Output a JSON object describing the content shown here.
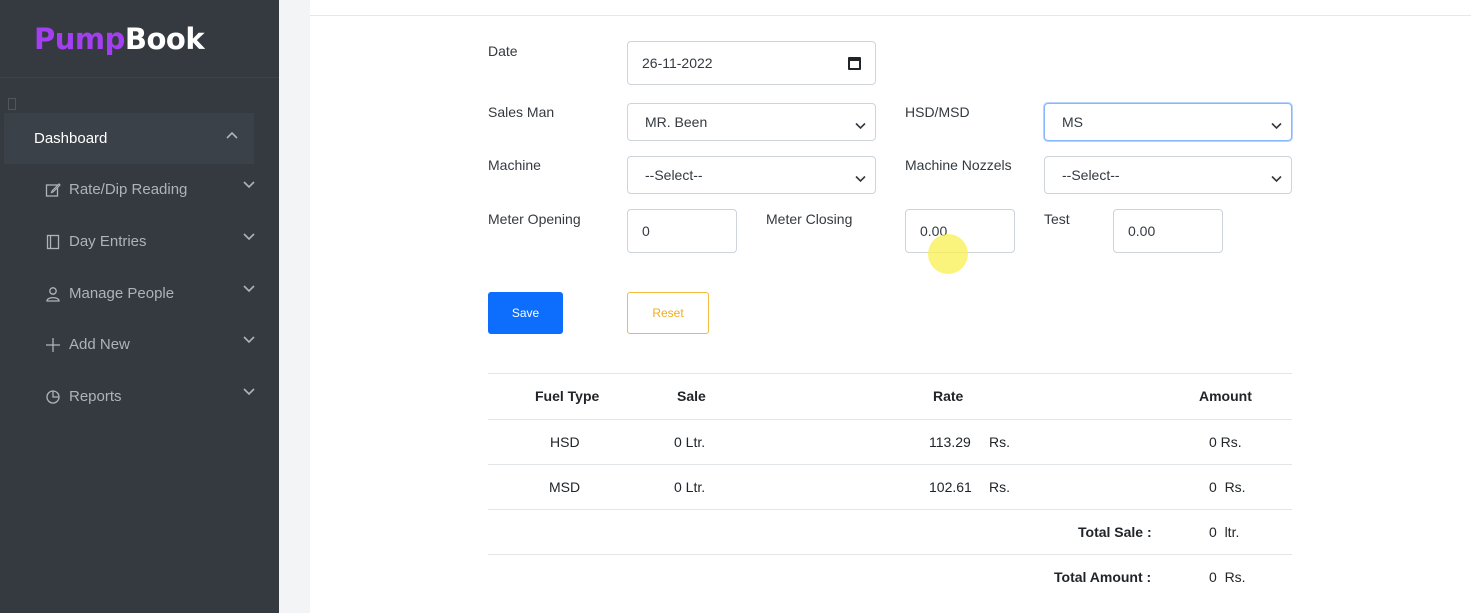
{
  "brand": {
    "part1": "Pump",
    "part2": "Book"
  },
  "sidebar": {
    "dashboard": "Dashboard",
    "items": [
      {
        "label": "Rate/Dip Reading",
        "icon": "edit-icon"
      },
      {
        "label": "Day Entries",
        "icon": "book-icon"
      },
      {
        "label": "Manage People",
        "icon": "person-icon"
      },
      {
        "label": "Add New",
        "icon": "plus-icon"
      },
      {
        "label": "Reports",
        "icon": "pie-chart-icon"
      }
    ]
  },
  "form": {
    "date_label": "Date",
    "date_value": "26-11-2022",
    "salesman_label": "Sales Man",
    "salesman_value": "MR. Been",
    "hsd_msd_label": "HSD/MSD",
    "hsd_msd_value": "MS",
    "machine_label": "Machine",
    "machine_value": "--Select--",
    "nozzles_label": "Machine Nozzels",
    "nozzles_value": "--Select--",
    "meter_opening_label": "Meter Opening",
    "meter_opening_value": "0",
    "meter_closing_label": "Meter Closing",
    "meter_closing_value": "0.00",
    "test_label": "Test",
    "test_value": "0.00",
    "save_label": "Save",
    "reset_label": "Reset"
  },
  "table": {
    "headers": {
      "fuel_type": "Fuel Type",
      "sale": "Sale",
      "rate": "Rate",
      "amount": "Amount"
    },
    "rows": [
      {
        "fuel_type": "HSD",
        "sale": "0 Ltr.",
        "rate": "113.29",
        "rate_unit": "Rs.",
        "amount": "0 Rs."
      },
      {
        "fuel_type": "MSD",
        "sale": "0 Ltr.",
        "rate": "102.61",
        "rate_unit": "Rs.",
        "amount": "0  Rs."
      }
    ],
    "total_sale_label": "Total Sale :",
    "total_sale_value": "0  ltr.",
    "total_amount_label": "Total Amount :",
    "total_amount_value": "0  Rs."
  },
  "colors": {
    "sidebar_bg": "#343a40",
    "brand_accent": "#a33ff0",
    "primary": "#0d6efd",
    "warning": "#f0ad1b"
  }
}
